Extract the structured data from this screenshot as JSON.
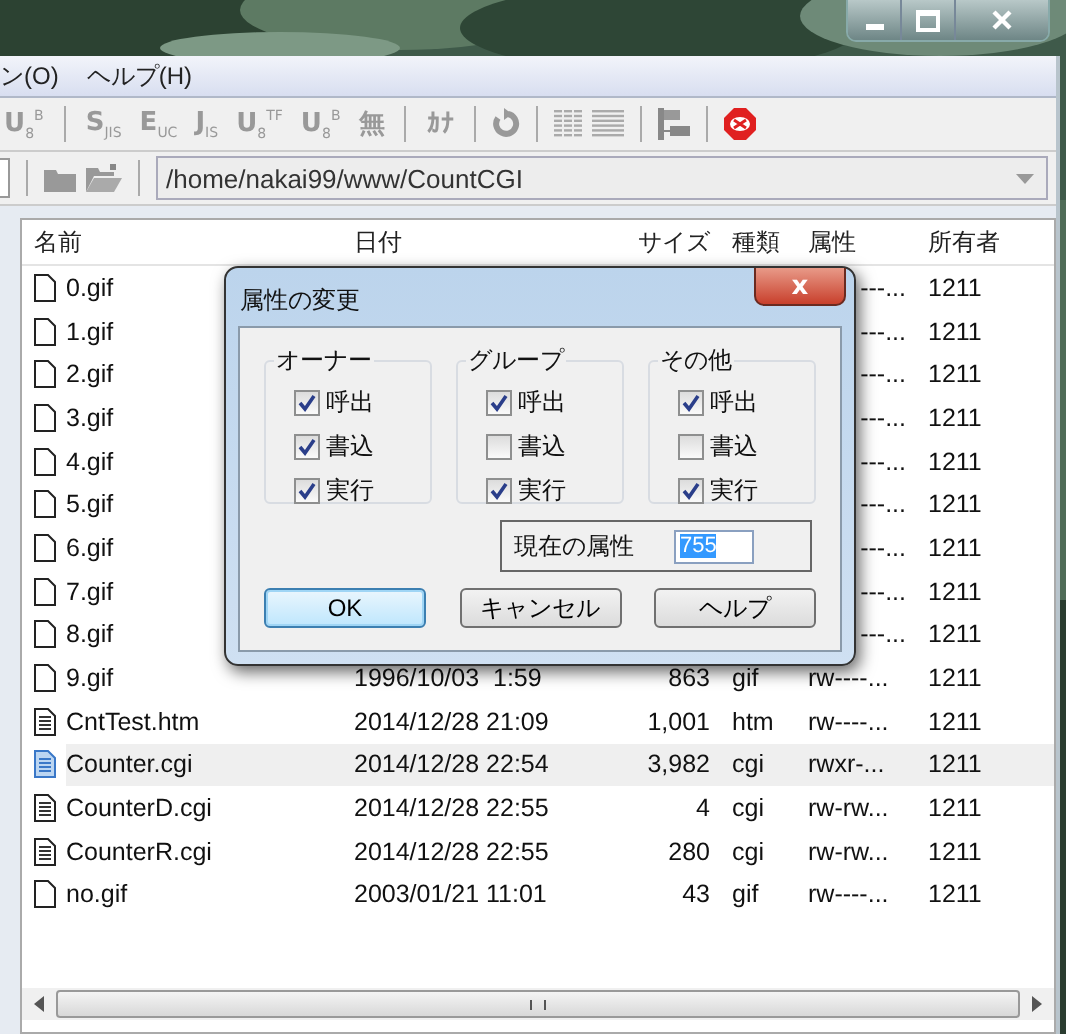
{
  "menu": [
    {
      "label": "ン(O)"
    },
    {
      "label": "ヘルプ(H)"
    }
  ],
  "toolbar": [
    {
      "kind": "code",
      "label": "U$_{8}$$^{B}$"
    },
    {
      "kind": "sep"
    },
    {
      "kind": "code",
      "label": "S$_{JIS}$"
    },
    {
      "kind": "code",
      "label": "E$_{UC}$"
    },
    {
      "kind": "code",
      "label": "J$_{IS}$"
    },
    {
      "kind": "code",
      "label": "U$_{8}$$^{TF}$"
    },
    {
      "kind": "code",
      "label": "U$_{8}$$^{B}$"
    },
    {
      "kind": "code",
      "label": "無"
    },
    {
      "kind": "sep"
    },
    {
      "kind": "code",
      "label": "ｶﾅ"
    },
    {
      "kind": "sep"
    },
    {
      "kind": "refresh"
    },
    {
      "kind": "sep"
    },
    {
      "kind": "grid"
    },
    {
      "kind": "list"
    },
    {
      "kind": "sep"
    },
    {
      "kind": "tree"
    },
    {
      "kind": "sep"
    },
    {
      "kind": "stop"
    }
  ],
  "path": {
    "value": "/home/nakai99/www/CountCGI"
  },
  "table": {
    "columns": [
      "名前",
      "日付",
      "サイズ",
      "種類",
      "属性",
      "所有者"
    ],
    "rows": [
      {
        "kind": "plain",
        "name": "0.gif",
        "attr": "---...",
        "owner": "1211",
        "selected": false
      },
      {
        "kind": "plain",
        "name": "1.gif",
        "attr": "---...",
        "owner": "1211",
        "selected": false
      },
      {
        "kind": "plain",
        "name": "2.gif",
        "attr": "---...",
        "owner": "1211",
        "selected": false
      },
      {
        "kind": "plain",
        "name": "3.gif",
        "attr": "---...",
        "owner": "1211",
        "selected": false
      },
      {
        "kind": "plain",
        "name": "4.gif",
        "attr": "---...",
        "owner": "1211",
        "selected": false
      },
      {
        "kind": "plain",
        "name": "5.gif",
        "attr": "---...",
        "owner": "1211",
        "selected": false
      },
      {
        "kind": "plain",
        "name": "6.gif",
        "attr": "---...",
        "owner": "1211",
        "selected": false
      },
      {
        "kind": "plain",
        "name": "7.gif",
        "attr": "---...",
        "owner": "1211",
        "selected": false
      },
      {
        "kind": "plain",
        "name": "8.gif",
        "attr": "---...",
        "owner": "1211",
        "selected": false
      },
      {
        "kind": "plain",
        "name": "9.gif",
        "date": "1996/10/03  1:59",
        "size": "863",
        "type": "gif",
        "attr": "rw----...",
        "owner": "1211",
        "selected": false
      },
      {
        "kind": "text",
        "name": "CntTest.htm",
        "date": "2014/12/28 21:09",
        "size": "1,001",
        "type": "htm",
        "attr": "rw----...",
        "owner": "1211",
        "selected": false
      },
      {
        "kind": "text",
        "name": "Counter.cgi",
        "date": "2014/12/28 22:54",
        "size": "3,982",
        "type": "cgi",
        "attr": "rwxr-...",
        "owner": "1211",
        "selected": true
      },
      {
        "kind": "text",
        "name": "CounterD.cgi",
        "date": "2014/12/28 22:55",
        "size": "4",
        "type": "cgi",
        "attr": "rw-rw...",
        "owner": "1211",
        "selected": false
      },
      {
        "kind": "text",
        "name": "CounterR.cgi",
        "date": "2014/12/28 22:55",
        "size": "280",
        "type": "cgi",
        "attr": "rw-rw...",
        "owner": "1211",
        "selected": false
      },
      {
        "kind": "plain",
        "name": "no.gif",
        "date": "2003/01/21 11:01",
        "size": "43",
        "type": "gif",
        "attr": "rw----...",
        "owner": "1211",
        "selected": false
      }
    ]
  },
  "dialog": {
    "title": "属性の変更",
    "close": "x",
    "groups": [
      {
        "title": "オーナー",
        "options": [
          {
            "label": "呼出",
            "checked": true
          },
          {
            "label": "書込",
            "checked": true
          },
          {
            "label": "実行",
            "checked": true
          }
        ]
      },
      {
        "title": "グループ",
        "options": [
          {
            "label": "呼出",
            "checked": true
          },
          {
            "label": "書込",
            "checked": false
          },
          {
            "label": "実行",
            "checked": true
          }
        ]
      },
      {
        "title": "その他",
        "options": [
          {
            "label": "呼出",
            "checked": true
          },
          {
            "label": "書込",
            "checked": false
          },
          {
            "label": "実行",
            "checked": true
          }
        ]
      }
    ],
    "current_label": "現在の属性",
    "current_value": "755",
    "buttons": [
      {
        "label": "OK",
        "focused": true
      },
      {
        "label": "キャンセル",
        "focused": false
      },
      {
        "label": "ヘルプ",
        "focused": false
      }
    ]
  }
}
